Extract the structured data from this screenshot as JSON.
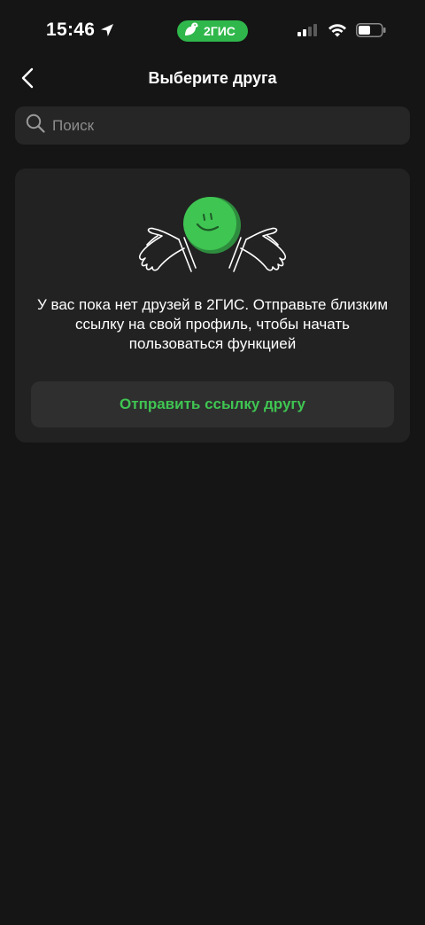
{
  "status_bar": {
    "time": "15:46",
    "app_badge": "2ГИС",
    "icons": [
      "location-arrow-icon",
      "cellular-signal-icon",
      "wifi-icon",
      "battery-icon"
    ]
  },
  "header": {
    "title": "Выберите друга",
    "back_icon": "chevron-left-icon"
  },
  "search": {
    "placeholder": "Поиск",
    "value": ""
  },
  "empty_state": {
    "message": "У вас пока нет друзей в 2ГИС. Отправьте близким ссылку на свой профиль, чтобы начать пользоваться функцией",
    "button_label": "Отправить ссылку другу",
    "illustration": "smiley-ball-hands-illustration"
  },
  "colors": {
    "background": "#151515",
    "card": "#222222",
    "accent_green": "#3fc552",
    "brand_green": "#2fb74b"
  }
}
